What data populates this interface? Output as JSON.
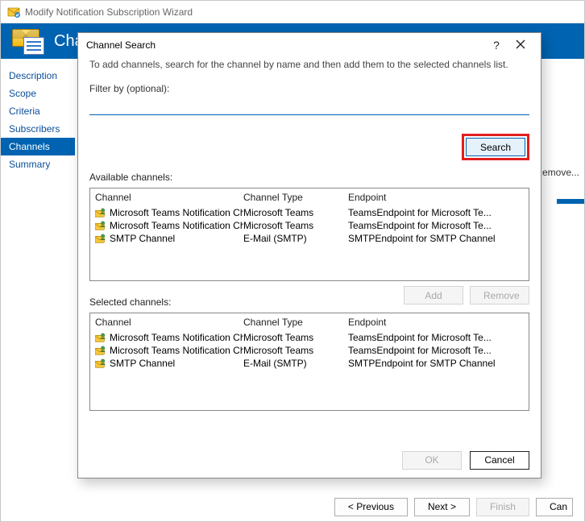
{
  "parent": {
    "title": "Modify Notification Subscription Wizard",
    "header_title": "Cha",
    "remove_label": "Remove...",
    "footer": {
      "prev": "< Previous",
      "next": "Next >",
      "finish": "Finish",
      "can": "Can"
    },
    "sidebar": [
      {
        "label": "Description",
        "active": false
      },
      {
        "label": "Scope",
        "active": false
      },
      {
        "label": "Criteria",
        "active": false
      },
      {
        "label": "Subscribers",
        "active": false
      },
      {
        "label": "Channels",
        "active": true
      },
      {
        "label": "Summary",
        "active": false
      }
    ]
  },
  "dialog": {
    "title": "Channel Search",
    "hint": "To add channels, search for the channel by name and then add them to the selected channels list.",
    "filter_label": "Filter by (optional):",
    "filter_value": "",
    "search_label": "Search",
    "available_label": "Available channels:",
    "selected_label": "Selected channels:",
    "columns": {
      "c1": "Channel",
      "c2": "Channel Type",
      "c3": "Endpoint"
    },
    "available": [
      {
        "channel": "Microsoft Teams Notification Channel",
        "type": "Microsoft Teams",
        "endpoint": "TeamsEndpoint for Microsoft Te..."
      },
      {
        "channel": "Microsoft Teams Notification Chann...",
        "type": "Microsoft Teams",
        "endpoint": "TeamsEndpoint for Microsoft Te..."
      },
      {
        "channel": "SMTP Channel",
        "type": "E-Mail (SMTP)",
        "endpoint": "SMTPEndpoint for SMTP Channel"
      }
    ],
    "selected": [
      {
        "channel": "Microsoft Teams Notification Channel",
        "type": "Microsoft Teams",
        "endpoint": "TeamsEndpoint for Microsoft Te..."
      },
      {
        "channel": "Microsoft Teams Notification Chann...",
        "type": "Microsoft Teams",
        "endpoint": "TeamsEndpoint for Microsoft Te..."
      },
      {
        "channel": "SMTP Channel",
        "type": "E-Mail (SMTP)",
        "endpoint": "SMTPEndpoint for SMTP Channel"
      }
    ],
    "add_label": "Add",
    "remove_label": "Remove",
    "ok_label": "OK",
    "cancel_label": "Cancel"
  }
}
